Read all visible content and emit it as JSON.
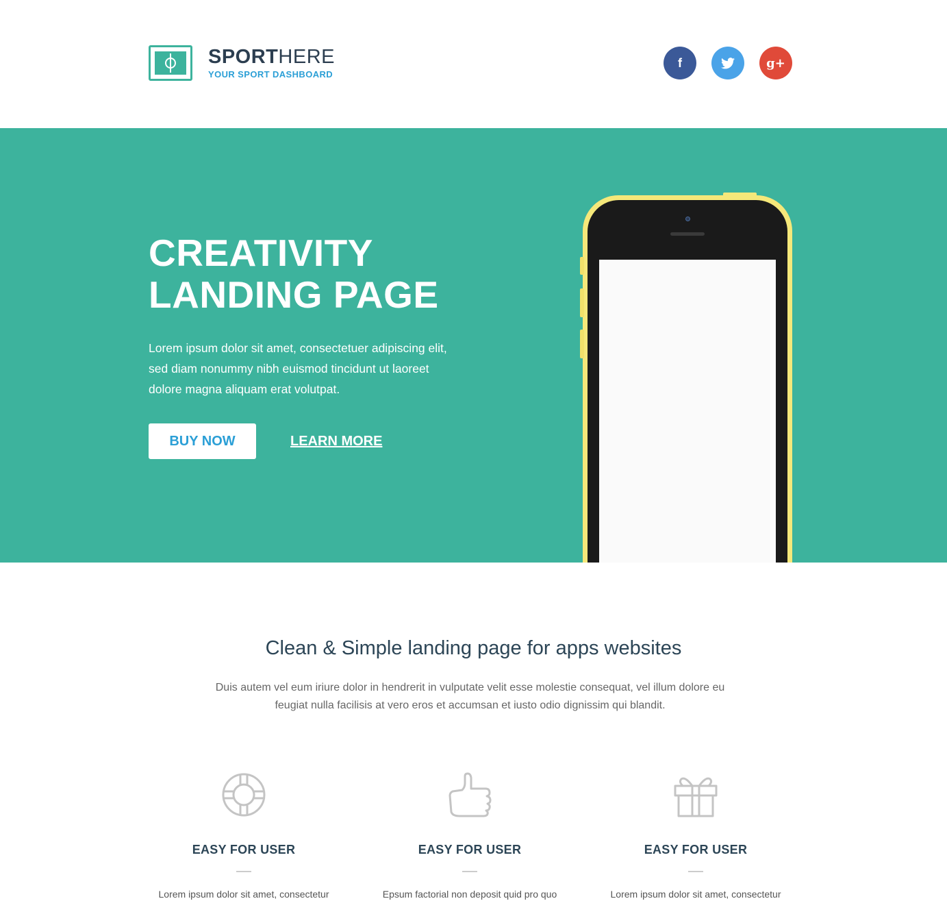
{
  "brand": {
    "name_bold": "SPORT",
    "name_light": "HERE",
    "tagline": "YOUR SPORT DASHBOARD"
  },
  "social": [
    {
      "name": "facebook",
      "glyph": "f",
      "color": "#3b5998"
    },
    {
      "name": "twitter",
      "color": "#4aa3e8"
    },
    {
      "name": "google-plus",
      "glyph": "g+",
      "color": "#e04a39"
    }
  ],
  "hero": {
    "title_line1": "CREATIVITY",
    "title_line2": "LANDING PAGE",
    "text_line1": "Lorem ipsum dolor sit amet, consectetuer adipiscing elit,",
    "text_line2": "sed diam nonummy nibh euismod tincidunt ut laoreet",
    "text_line3": "dolore magna aliquam erat volutpat.",
    "buy_label": "BUY NOW",
    "learn_label": "LEARN MORE",
    "background": "#3db39d"
  },
  "section": {
    "title": "Clean & Simple landing page for apps websites",
    "text_line1": "Duis autem vel eum iriure dolor in hendrerit in vulputate velit esse molestie consequat, vel illum dolore eu",
    "text_line2": "feugiat nulla facilisis at vero eros et accumsan et iusto odio dignissim qui blandit."
  },
  "features": [
    {
      "icon": "lifebuoy-icon",
      "title": "EASY FOR USER",
      "text": "Lorem ipsum dolor sit amet, consectetur"
    },
    {
      "icon": "thumbs-up-icon",
      "title": "EASY FOR USER",
      "text": "Epsum factorial non deposit quid pro quo"
    },
    {
      "icon": "gift-icon",
      "title": "EASY FOR USER",
      "text": "Lorem ipsum dolor sit amet, consectetur"
    }
  ]
}
